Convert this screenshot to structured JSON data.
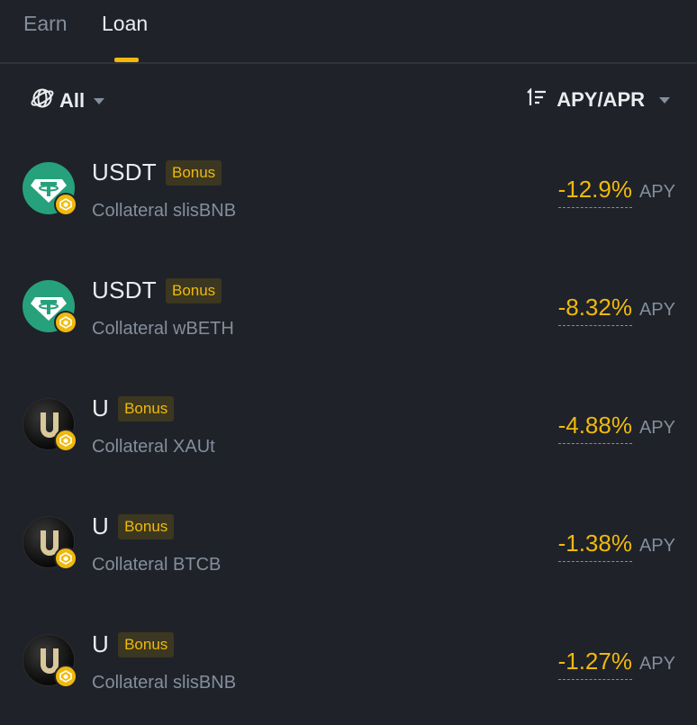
{
  "tabs": [
    {
      "label": "Earn",
      "active": false
    },
    {
      "label": "Loan",
      "active": true
    }
  ],
  "filters": {
    "network_label": "All",
    "sort_label": "APY/APR"
  },
  "colors": {
    "accent": "#f0b90b",
    "background": "#1f2229",
    "muted": "#848e9c",
    "usdt": "#26a17b"
  },
  "items": [
    {
      "asset": "USDT",
      "icon": "usdt-icon",
      "bonus": "Bonus",
      "collateral": "Collateral slisBNB",
      "rate": "-12.9%",
      "unit": "APY"
    },
    {
      "asset": "USDT",
      "icon": "usdt-icon",
      "bonus": "Bonus",
      "collateral": "Collateral wBETH",
      "rate": "-8.32%",
      "unit": "APY"
    },
    {
      "asset": "U",
      "icon": "u-coin-icon",
      "bonus": "Bonus",
      "collateral": "Collateral XAUt",
      "rate": "-4.88%",
      "unit": "APY"
    },
    {
      "asset": "U",
      "icon": "u-coin-icon",
      "bonus": "Bonus",
      "collateral": "Collateral BTCB",
      "rate": "-1.38%",
      "unit": "APY"
    },
    {
      "asset": "U",
      "icon": "u-coin-icon",
      "bonus": "Bonus",
      "collateral": "Collateral slisBNB",
      "rate": "-1.27%",
      "unit": "APY"
    }
  ]
}
